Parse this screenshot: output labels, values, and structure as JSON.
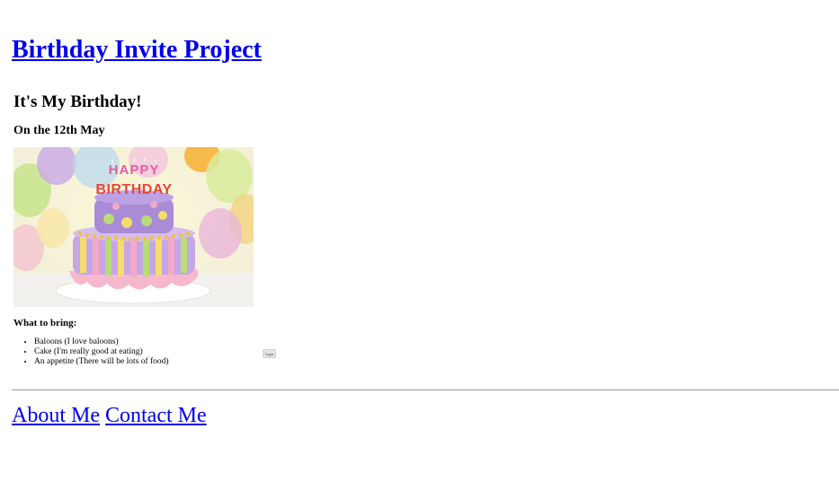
{
  "header": {
    "title": "Birthday Invite Project"
  },
  "invite": {
    "heading": "It's My Birthday!",
    "date": "On the 12th May",
    "image_text": "HAPPY BIRTHDAY",
    "bring_heading": "What to bring:",
    "bring_items": [
      "Baloons (I love baloons)",
      "Cake (I'm really good at eating)",
      "An appetite (There will be lots of food)"
    ],
    "small_button_label": "Toggle"
  },
  "footer": {
    "links": [
      "About Me",
      "Contact Me"
    ]
  },
  "colors": {
    "link": "#0000ee",
    "divider": "#9a9a9a"
  }
}
